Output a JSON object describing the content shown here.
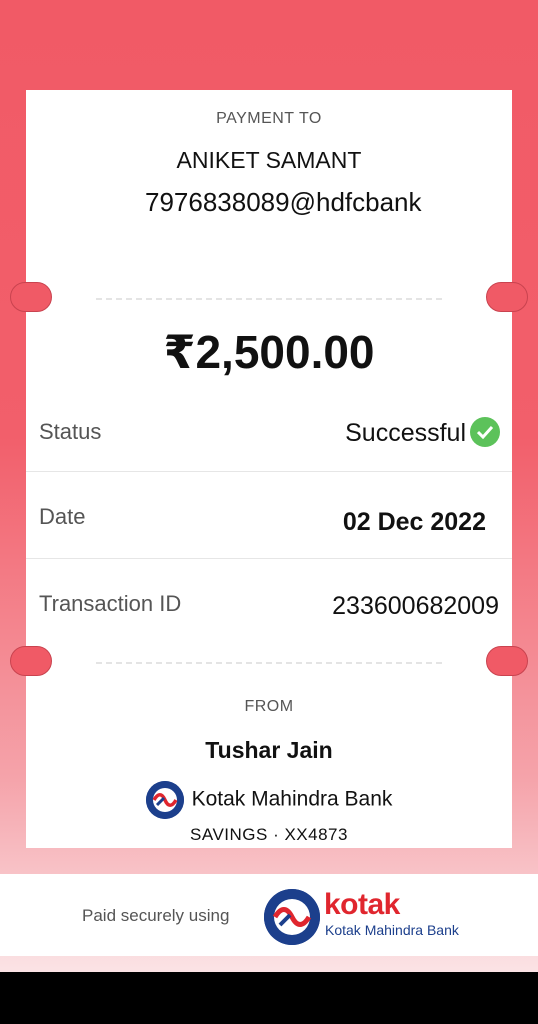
{
  "payee": {
    "section_label": "PAYMENT TO",
    "name": "ANIKET SAMANT",
    "upi_id": "7976838089@hdfcbank"
  },
  "amount": "₹2,500.00",
  "details": {
    "status_label": "Status",
    "status_value": "Successful",
    "date_label": "Date",
    "date_value": "02 Dec 2022",
    "txn_label": "Transaction ID",
    "txn_value": "233600682009"
  },
  "from": {
    "section_label": "FROM",
    "name": "Tushar Jain",
    "bank": "Kotak Mahindra Bank",
    "account": "SAVINGS · XX4873"
  },
  "footer": {
    "paid_text": "Paid securely using",
    "brand_word": "kotak",
    "brand_sub": "Kotak Mahindra Bank"
  },
  "colors": {
    "background": "#f15a66",
    "success": "#5cc25a",
    "brand_blue": "#1c3f8c",
    "brand_red": "#e0262e"
  }
}
